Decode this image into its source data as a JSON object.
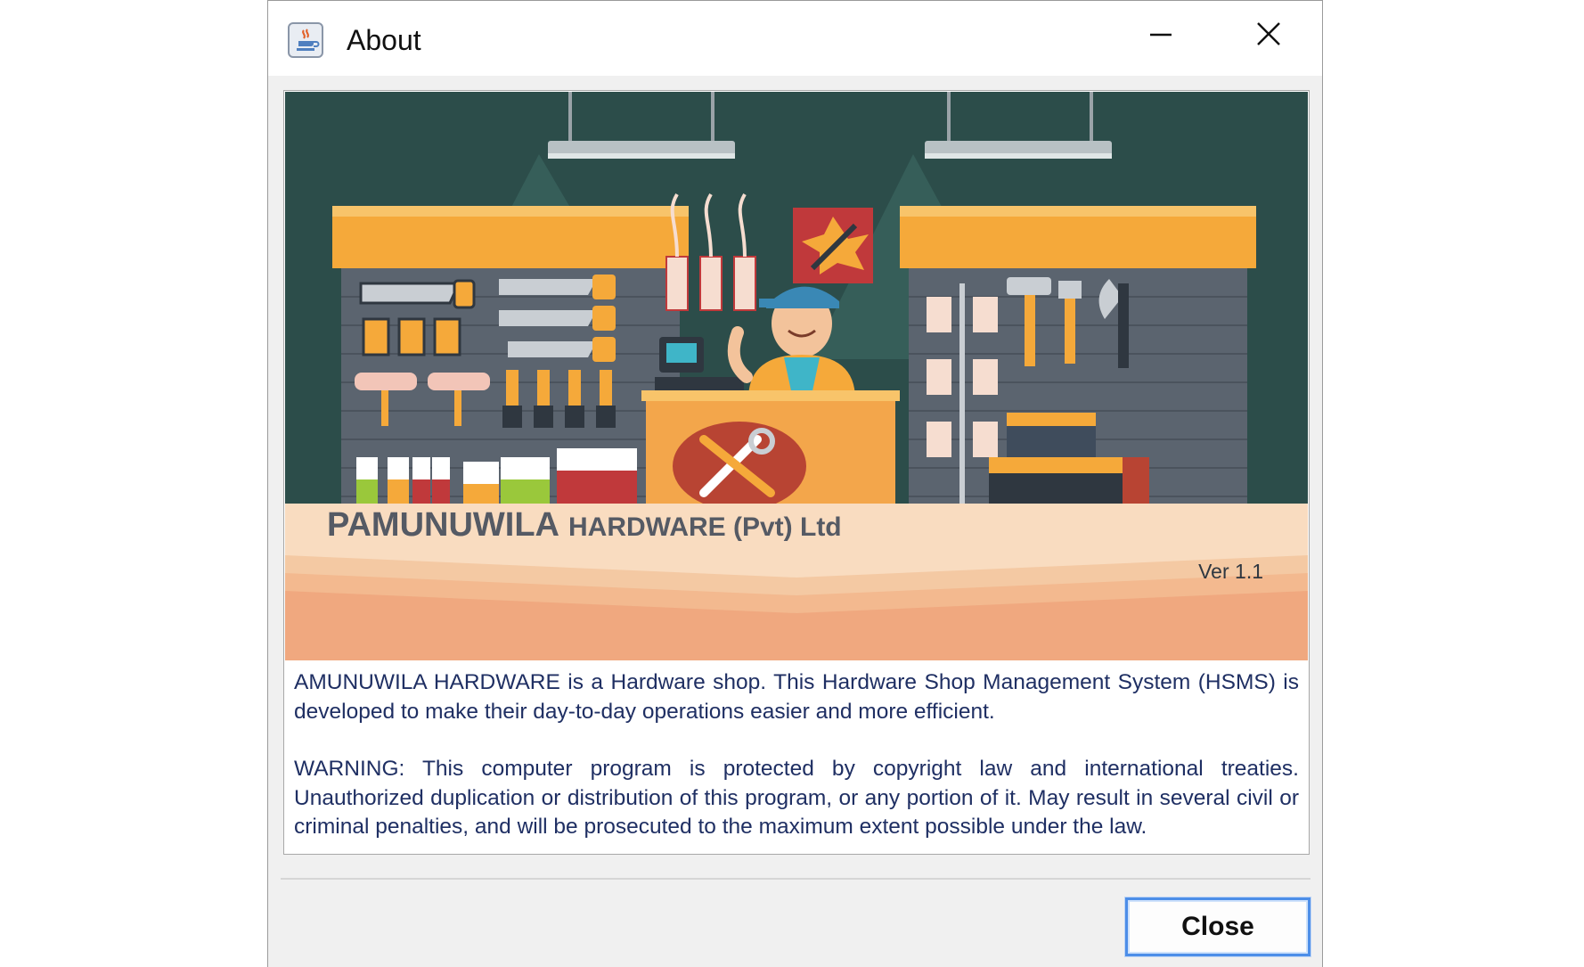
{
  "window": {
    "title": "About",
    "icon": "java-coffee-icon",
    "minimize_icon": "minimize-icon",
    "close_icon": "close-icon"
  },
  "banner": {
    "company_name": "PAMUNUWILA",
    "company_suffix": "HARDWARE (Pvt) Ltd",
    "version": "Ver 1.1",
    "colors": {
      "background": "#2c4d4a",
      "shelf_orange": "#f5a93a",
      "wall_gray": "#5b646f",
      "counter_orange": "#f3a64b",
      "floor_band": "#f8dcbd"
    }
  },
  "description": {
    "paragraph1": "AMUNUWILA HARDWARE is a Hardware shop. This Hardware Shop Management System (HSMS) is developed to make their day-to-day operations easier and more efficient.",
    "paragraph2": "WARNING: This computer program is protected by copyright law and international treaties. Unauthorized duplication or distribution of this program, or any portion of it. May result in several civil or criminal penalties, and will be prosecuted to the maximum extent possible under the law."
  },
  "buttons": {
    "close_label": "Close"
  }
}
